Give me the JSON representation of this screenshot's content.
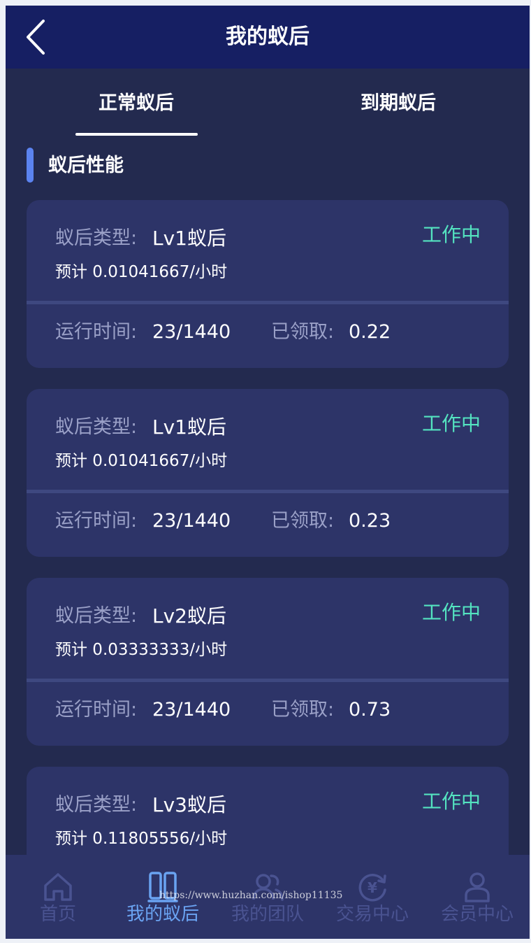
{
  "nav": {
    "title": "我的蚁后"
  },
  "tabs": [
    {
      "label": "正常蚁后",
      "active": true
    },
    {
      "label": "到期蚁后",
      "active": false
    }
  ],
  "section": {
    "title": "蚁后性能"
  },
  "labels": {
    "type": "蚁后类型:",
    "run_time": "运行时间:",
    "received": "已领取:"
  },
  "cards": [
    {
      "type": "Lv1蚁后",
      "status": "工作中",
      "estimate": "预计 0.01041667/小时",
      "run_time": "23/1440",
      "received": "0.22"
    },
    {
      "type": "Lv1蚁后",
      "status": "工作中",
      "estimate": "预计 0.01041667/小时",
      "run_time": "23/1440",
      "received": "0.23"
    },
    {
      "type": "Lv2蚁后",
      "status": "工作中",
      "estimate": "预计 0.03333333/小时",
      "run_time": "23/1440",
      "received": "0.73"
    },
    {
      "type": "Lv3蚁后",
      "status": "工作中",
      "estimate": "预计 0.11805556/小时",
      "run_time": "",
      "received": ""
    }
  ],
  "tabbar": [
    {
      "label": "首页",
      "icon": "home-icon",
      "active": false
    },
    {
      "label": "我的蚁后",
      "icon": "book-icon",
      "active": true
    },
    {
      "label": "我的团队",
      "icon": "team-icon",
      "active": false
    },
    {
      "label": "交易中心",
      "icon": "exchange-icon",
      "active": false
    },
    {
      "label": "会员中心",
      "icon": "user-icon",
      "active": false
    }
  ],
  "watermark": "https://www.huzhan.com/ishop11135",
  "colors": {
    "background": "#232a4f",
    "nav": "#161f63",
    "card": "#2d3468",
    "status": "#54e3c0",
    "accent": "#5b83f0",
    "tab_active": "#6aa3f2",
    "tab_inactive": "#4a5391"
  }
}
